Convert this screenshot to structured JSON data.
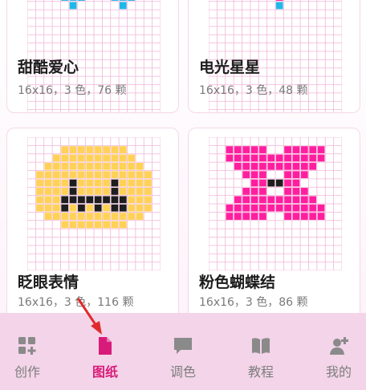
{
  "colors": {
    "accent": "#d81b7a",
    "grid_line": "#f2b5d8",
    "tab_bar": "#f3d4e8",
    "cyan": "#1fb8e8",
    "pink": "#ff1f9e",
    "yellow": "#ffd256",
    "black": "#1e1e1e",
    "arrow": "#e02a2a"
  },
  "patterns": [
    {
      "title": "甜酷爱心",
      "meta": "16x16，3 色，76 颗",
      "cells": [
        {
          "c": 5,
          "r": 0,
          "k": "cyan"
        },
        {
          "c": 11,
          "r": 0,
          "k": "cyan"
        },
        {
          "c": 4,
          "r": 1,
          "k": "cyan"
        },
        {
          "c": 5,
          "r": 1,
          "k": "cyan"
        },
        {
          "c": 6,
          "r": 1,
          "k": "cyan"
        },
        {
          "c": 10,
          "r": 1,
          "k": "cyan"
        },
        {
          "c": 11,
          "r": 1,
          "k": "cyan"
        },
        {
          "c": 12,
          "r": 1,
          "k": "cyan"
        },
        {
          "c": 5,
          "r": 2,
          "k": "cyan"
        },
        {
          "c": 11,
          "r": 2,
          "k": "cyan"
        }
      ]
    },
    {
      "title": "电光星星",
      "meta": "16x16，3 色，48 颗",
      "cells": [
        {
          "c": 4,
          "r": 0,
          "k": "pink"
        },
        {
          "c": 12,
          "r": 0,
          "k": "pink"
        },
        {
          "c": 8,
          "r": 1,
          "k": "pink"
        },
        {
          "c": 8,
          "r": 2,
          "k": "cyan"
        }
      ]
    },
    {
      "title": "眨眼表情",
      "meta": "16x16，3 色，116 颗",
      "cells": [
        {
          "c": 4,
          "r": 1,
          "k": "yellow"
        },
        {
          "c": 5,
          "r": 1,
          "k": "yellow"
        },
        {
          "c": 6,
          "r": 1,
          "k": "yellow"
        },
        {
          "c": 7,
          "r": 1,
          "k": "yellow"
        },
        {
          "c": 8,
          "r": 1,
          "k": "yellow"
        },
        {
          "c": 9,
          "r": 1,
          "k": "yellow"
        },
        {
          "c": 10,
          "r": 1,
          "k": "yellow"
        },
        {
          "c": 11,
          "r": 1,
          "k": "yellow"
        },
        {
          "c": 3,
          "r": 2,
          "k": "yellow"
        },
        {
          "c": 4,
          "r": 2,
          "k": "yellow"
        },
        {
          "c": 5,
          "r": 2,
          "k": "yellow"
        },
        {
          "c": 6,
          "r": 2,
          "k": "yellow"
        },
        {
          "c": 7,
          "r": 2,
          "k": "yellow"
        },
        {
          "c": 8,
          "r": 2,
          "k": "yellow"
        },
        {
          "c": 9,
          "r": 2,
          "k": "yellow"
        },
        {
          "c": 10,
          "r": 2,
          "k": "yellow"
        },
        {
          "c": 11,
          "r": 2,
          "k": "yellow"
        },
        {
          "c": 12,
          "r": 2,
          "k": "yellow"
        },
        {
          "c": 2,
          "r": 3,
          "k": "yellow"
        },
        {
          "c": 3,
          "r": 3,
          "k": "yellow"
        },
        {
          "c": 4,
          "r": 3,
          "k": "yellow"
        },
        {
          "c": 5,
          "r": 3,
          "k": "yellow"
        },
        {
          "c": 6,
          "r": 3,
          "k": "yellow"
        },
        {
          "c": 7,
          "r": 3,
          "k": "yellow"
        },
        {
          "c": 8,
          "r": 3,
          "k": "yellow"
        },
        {
          "c": 9,
          "r": 3,
          "k": "yellow"
        },
        {
          "c": 10,
          "r": 3,
          "k": "yellow"
        },
        {
          "c": 11,
          "r": 3,
          "k": "yellow"
        },
        {
          "c": 12,
          "r": 3,
          "k": "yellow"
        },
        {
          "c": 13,
          "r": 3,
          "k": "yellow"
        },
        {
          "c": 1,
          "r": 4,
          "k": "yellow"
        },
        {
          "c": 2,
          "r": 4,
          "k": "yellow"
        },
        {
          "c": 3,
          "r": 4,
          "k": "yellow"
        },
        {
          "c": 4,
          "r": 4,
          "k": "yellow"
        },
        {
          "c": 5,
          "r": 4,
          "k": "yellow"
        },
        {
          "c": 6,
          "r": 4,
          "k": "yellow"
        },
        {
          "c": 7,
          "r": 4,
          "k": "yellow"
        },
        {
          "c": 8,
          "r": 4,
          "k": "yellow"
        },
        {
          "c": 9,
          "r": 4,
          "k": "yellow"
        },
        {
          "c": 10,
          "r": 4,
          "k": "yellow"
        },
        {
          "c": 11,
          "r": 4,
          "k": "yellow"
        },
        {
          "c": 12,
          "r": 4,
          "k": "yellow"
        },
        {
          "c": 13,
          "r": 4,
          "k": "yellow"
        },
        {
          "c": 14,
          "r": 4,
          "k": "yellow"
        },
        {
          "c": 1,
          "r": 5,
          "k": "yellow"
        },
        {
          "c": 2,
          "r": 5,
          "k": "yellow"
        },
        {
          "c": 3,
          "r": 5,
          "k": "yellow"
        },
        {
          "c": 4,
          "r": 5,
          "k": "yellow"
        },
        {
          "c": 5,
          "r": 5,
          "k": "black"
        },
        {
          "c": 6,
          "r": 5,
          "k": "yellow"
        },
        {
          "c": 7,
          "r": 5,
          "k": "yellow"
        },
        {
          "c": 8,
          "r": 5,
          "k": "yellow"
        },
        {
          "c": 9,
          "r": 5,
          "k": "yellow"
        },
        {
          "c": 10,
          "r": 5,
          "k": "black"
        },
        {
          "c": 11,
          "r": 5,
          "k": "yellow"
        },
        {
          "c": 12,
          "r": 5,
          "k": "yellow"
        },
        {
          "c": 13,
          "r": 5,
          "k": "yellow"
        },
        {
          "c": 14,
          "r": 5,
          "k": "yellow"
        },
        {
          "c": 1,
          "r": 6,
          "k": "yellow"
        },
        {
          "c": 2,
          "r": 6,
          "k": "yellow"
        },
        {
          "c": 3,
          "r": 6,
          "k": "yellow"
        },
        {
          "c": 4,
          "r": 6,
          "k": "yellow"
        },
        {
          "c": 5,
          "r": 6,
          "k": "black"
        },
        {
          "c": 6,
          "r": 6,
          "k": "yellow"
        },
        {
          "c": 7,
          "r": 6,
          "k": "yellow"
        },
        {
          "c": 8,
          "r": 6,
          "k": "yellow"
        },
        {
          "c": 9,
          "r": 6,
          "k": "yellow"
        },
        {
          "c": 10,
          "r": 6,
          "k": "black"
        },
        {
          "c": 11,
          "r": 6,
          "k": "yellow"
        },
        {
          "c": 12,
          "r": 6,
          "k": "yellow"
        },
        {
          "c": 13,
          "r": 6,
          "k": "yellow"
        },
        {
          "c": 14,
          "r": 6,
          "k": "yellow"
        },
        {
          "c": 1,
          "r": 7,
          "k": "yellow"
        },
        {
          "c": 2,
          "r": 7,
          "k": "yellow"
        },
        {
          "c": 3,
          "r": 7,
          "k": "yellow"
        },
        {
          "c": 4,
          "r": 7,
          "k": "black"
        },
        {
          "c": 5,
          "r": 7,
          "k": "black"
        },
        {
          "c": 6,
          "r": 7,
          "k": "black"
        },
        {
          "c": 7,
          "r": 7,
          "k": "black"
        },
        {
          "c": 8,
          "r": 7,
          "k": "black"
        },
        {
          "c": 9,
          "r": 7,
          "k": "black"
        },
        {
          "c": 10,
          "r": 7,
          "k": "black"
        },
        {
          "c": 11,
          "r": 7,
          "k": "black"
        },
        {
          "c": 12,
          "r": 7,
          "k": "yellow"
        },
        {
          "c": 13,
          "r": 7,
          "k": "yellow"
        },
        {
          "c": 14,
          "r": 7,
          "k": "yellow"
        },
        {
          "c": 1,
          "r": 8,
          "k": "yellow"
        },
        {
          "c": 2,
          "r": 8,
          "k": "yellow"
        },
        {
          "c": 3,
          "r": 8,
          "k": "yellow"
        },
        {
          "c": 4,
          "r": 8,
          "k": "black"
        },
        {
          "c": 5,
          "r": 8,
          "k": "yellow"
        },
        {
          "c": 6,
          "r": 8,
          "k": "black"
        },
        {
          "c": 7,
          "r": 8,
          "k": "yellow"
        },
        {
          "c": 8,
          "r": 8,
          "k": "black"
        },
        {
          "c": 9,
          "r": 8,
          "k": "yellow"
        },
        {
          "c": 10,
          "r": 8,
          "k": "black"
        },
        {
          "c": 11,
          "r": 8,
          "k": "black"
        },
        {
          "c": 12,
          "r": 8,
          "k": "yellow"
        },
        {
          "c": 13,
          "r": 8,
          "k": "yellow"
        },
        {
          "c": 14,
          "r": 8,
          "k": "yellow"
        },
        {
          "c": 2,
          "r": 9,
          "k": "yellow"
        },
        {
          "c": 3,
          "r": 9,
          "k": "yellow"
        },
        {
          "c": 4,
          "r": 9,
          "k": "yellow"
        },
        {
          "c": 5,
          "r": 9,
          "k": "yellow"
        },
        {
          "c": 6,
          "r": 9,
          "k": "yellow"
        },
        {
          "c": 7,
          "r": 9,
          "k": "yellow"
        },
        {
          "c": 8,
          "r": 9,
          "k": "yellow"
        },
        {
          "c": 9,
          "r": 9,
          "k": "yellow"
        },
        {
          "c": 10,
          "r": 9,
          "k": "yellow"
        },
        {
          "c": 11,
          "r": 9,
          "k": "yellow"
        },
        {
          "c": 12,
          "r": 9,
          "k": "yellow"
        },
        {
          "c": 13,
          "r": 9,
          "k": "yellow"
        },
        {
          "c": 4,
          "r": 10,
          "k": "yellow"
        },
        {
          "c": 5,
          "r": 10,
          "k": "yellow"
        },
        {
          "c": 6,
          "r": 10,
          "k": "yellow"
        },
        {
          "c": 7,
          "r": 10,
          "k": "yellow"
        },
        {
          "c": 8,
          "r": 10,
          "k": "yellow"
        },
        {
          "c": 9,
          "r": 10,
          "k": "yellow"
        },
        {
          "c": 10,
          "r": 10,
          "k": "yellow"
        },
        {
          "c": 11,
          "r": 10,
          "k": "yellow"
        }
      ]
    },
    {
      "title": "粉色蝴蝶结",
      "meta": "16x16，3 色，86 颗",
      "cells": [
        {
          "c": 2,
          "r": 1,
          "k": "pink"
        },
        {
          "c": 3,
          "r": 1,
          "k": "pink"
        },
        {
          "c": 4,
          "r": 1,
          "k": "pink"
        },
        {
          "c": 5,
          "r": 1,
          "k": "pink"
        },
        {
          "c": 6,
          "r": 1,
          "k": "pink"
        },
        {
          "c": 9,
          "r": 1,
          "k": "pink"
        },
        {
          "c": 10,
          "r": 1,
          "k": "pink"
        },
        {
          "c": 11,
          "r": 1,
          "k": "pink"
        },
        {
          "c": 12,
          "r": 1,
          "k": "pink"
        },
        {
          "c": 13,
          "r": 1,
          "k": "pink"
        },
        {
          "c": 2,
          "r": 2,
          "k": "pink"
        },
        {
          "c": 3,
          "r": 2,
          "k": "pink"
        },
        {
          "c": 4,
          "r": 2,
          "k": "pink"
        },
        {
          "c": 5,
          "r": 2,
          "k": "pink"
        },
        {
          "c": 6,
          "r": 2,
          "k": "pink"
        },
        {
          "c": 7,
          "r": 2,
          "k": "pink"
        },
        {
          "c": 8,
          "r": 2,
          "k": "pink"
        },
        {
          "c": 9,
          "r": 2,
          "k": "pink"
        },
        {
          "c": 10,
          "r": 2,
          "k": "pink"
        },
        {
          "c": 11,
          "r": 2,
          "k": "pink"
        },
        {
          "c": 12,
          "r": 2,
          "k": "pink"
        },
        {
          "c": 13,
          "r": 2,
          "k": "pink"
        },
        {
          "c": 3,
          "r": 3,
          "k": "pink"
        },
        {
          "c": 4,
          "r": 3,
          "k": "pink"
        },
        {
          "c": 5,
          "r": 3,
          "k": "pink"
        },
        {
          "c": 6,
          "r": 3,
          "k": "pink"
        },
        {
          "c": 7,
          "r": 3,
          "k": "pink"
        },
        {
          "c": 8,
          "r": 3,
          "k": "pink"
        },
        {
          "c": 9,
          "r": 3,
          "k": "pink"
        },
        {
          "c": 10,
          "r": 3,
          "k": "pink"
        },
        {
          "c": 11,
          "r": 3,
          "k": "pink"
        },
        {
          "c": 12,
          "r": 3,
          "k": "pink"
        },
        {
          "c": 4,
          "r": 4,
          "k": "pink"
        },
        {
          "c": 5,
          "r": 4,
          "k": "pink"
        },
        {
          "c": 6,
          "r": 4,
          "k": "pink"
        },
        {
          "c": 9,
          "r": 4,
          "k": "pink"
        },
        {
          "c": 10,
          "r": 4,
          "k": "pink"
        },
        {
          "c": 11,
          "r": 4,
          "k": "pink"
        },
        {
          "c": 5,
          "r": 5,
          "k": "pink"
        },
        {
          "c": 6,
          "r": 5,
          "k": "pink"
        },
        {
          "c": 7,
          "r": 5,
          "k": "black"
        },
        {
          "c": 8,
          "r": 5,
          "k": "black"
        },
        {
          "c": 9,
          "r": 5,
          "k": "pink"
        },
        {
          "c": 10,
          "r": 5,
          "k": "pink"
        },
        {
          "c": 4,
          "r": 6,
          "k": "pink"
        },
        {
          "c": 5,
          "r": 6,
          "k": "pink"
        },
        {
          "c": 6,
          "r": 6,
          "k": "pink"
        },
        {
          "c": 9,
          "r": 6,
          "k": "pink"
        },
        {
          "c": 10,
          "r": 6,
          "k": "pink"
        },
        {
          "c": 11,
          "r": 6,
          "k": "pink"
        },
        {
          "c": 3,
          "r": 7,
          "k": "pink"
        },
        {
          "c": 4,
          "r": 7,
          "k": "pink"
        },
        {
          "c": 5,
          "r": 7,
          "k": "pink"
        },
        {
          "c": 6,
          "r": 7,
          "k": "pink"
        },
        {
          "c": 7,
          "r": 7,
          "k": "pink"
        },
        {
          "c": 8,
          "r": 7,
          "k": "pink"
        },
        {
          "c": 9,
          "r": 7,
          "k": "pink"
        },
        {
          "c": 10,
          "r": 7,
          "k": "pink"
        },
        {
          "c": 11,
          "r": 7,
          "k": "pink"
        },
        {
          "c": 12,
          "r": 7,
          "k": "pink"
        },
        {
          "c": 2,
          "r": 8,
          "k": "pink"
        },
        {
          "c": 3,
          "r": 8,
          "k": "pink"
        },
        {
          "c": 4,
          "r": 8,
          "k": "pink"
        },
        {
          "c": 5,
          "r": 8,
          "k": "pink"
        },
        {
          "c": 6,
          "r": 8,
          "k": "pink"
        },
        {
          "c": 7,
          "r": 8,
          "k": "pink"
        },
        {
          "c": 8,
          "r": 8,
          "k": "pink"
        },
        {
          "c": 9,
          "r": 8,
          "k": "pink"
        },
        {
          "c": 10,
          "r": 8,
          "k": "pink"
        },
        {
          "c": 11,
          "r": 8,
          "k": "pink"
        },
        {
          "c": 12,
          "r": 8,
          "k": "pink"
        },
        {
          "c": 13,
          "r": 8,
          "k": "pink"
        },
        {
          "c": 2,
          "r": 9,
          "k": "pink"
        },
        {
          "c": 3,
          "r": 9,
          "k": "pink"
        },
        {
          "c": 4,
          "r": 9,
          "k": "pink"
        },
        {
          "c": 5,
          "r": 9,
          "k": "pink"
        },
        {
          "c": 6,
          "r": 9,
          "k": "pink"
        },
        {
          "c": 9,
          "r": 9,
          "k": "pink"
        },
        {
          "c": 10,
          "r": 9,
          "k": "pink"
        },
        {
          "c": 11,
          "r": 9,
          "k": "pink"
        },
        {
          "c": 12,
          "r": 9,
          "k": "pink"
        },
        {
          "c": 13,
          "r": 9,
          "k": "pink"
        }
      ]
    }
  ],
  "tabbar": {
    "tabs": [
      {
        "label": "创作",
        "icon": "grid-plus-icon",
        "active": false
      },
      {
        "label": "图纸",
        "icon": "document-icon",
        "active": true
      },
      {
        "label": "调色",
        "icon": "chat-bubble-icon",
        "active": false
      },
      {
        "label": "教程",
        "icon": "book-icon",
        "active": false
      },
      {
        "label": "我的",
        "icon": "person-add-icon",
        "active": false
      }
    ]
  }
}
